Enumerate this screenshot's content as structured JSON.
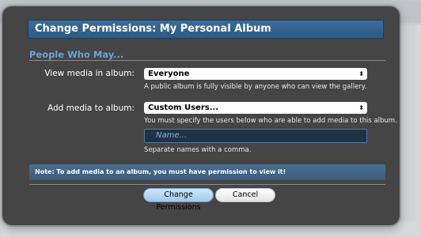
{
  "dialog": {
    "title": "Change Permissions: My Personal Album",
    "section_heading": "People Who May...",
    "view_label": "View media in album:",
    "view_value": "Everyone",
    "view_hint": "A public album is fully visible by anyone who can view the gallery.",
    "add_label": "Add media to album:",
    "add_value": "Custom Users...",
    "add_hint": "You must specify the users below who are able to add media to this album.",
    "name_placeholder": "Name...",
    "name_hint": "Separate names with a comma.",
    "note": "Note: To add media to an album, you must have permission to view it!",
    "submit_label": "Change Permissions",
    "cancel_label": "Cancel"
  },
  "icons": {
    "select_arrow": "up-down-arrow-icon"
  }
}
